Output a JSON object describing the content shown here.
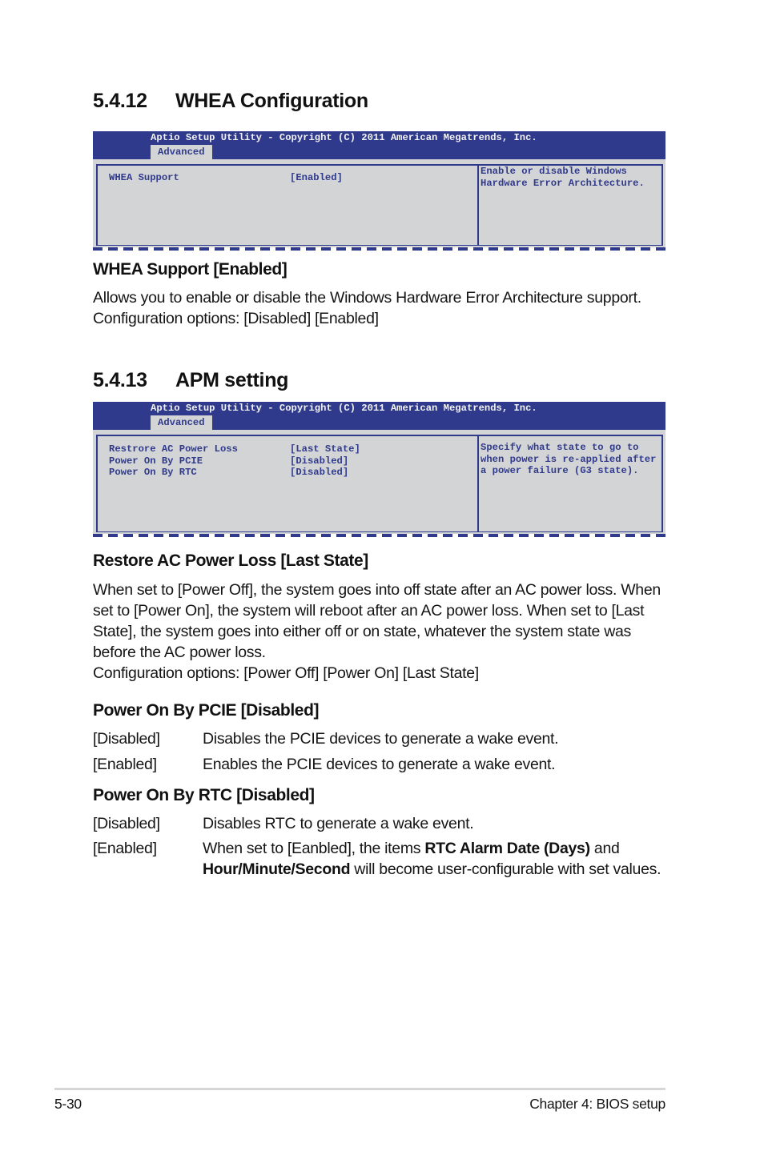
{
  "sections": [
    {
      "number": "5.4.12",
      "title": "WHEA Configuration",
      "bios": {
        "header_title": "Aptio Setup Utility - Copyright (C) 2011 American Megatrends, Inc.",
        "tab": "Advanced",
        "items": [
          {
            "label": "WHEA Support",
            "value": "[Enabled]"
          }
        ],
        "help_text": "Enable or disable Windows\nHardware Error Architecture."
      },
      "subsections": [
        {
          "heading": "WHEA Support [Enabled]",
          "paragraphs": [
            "Allows you to enable or disable the Windows Hardware Error Architecture support. Configuration options: [Disabled] [Enabled]"
          ]
        }
      ]
    },
    {
      "number": "5.4.13",
      "title": "APM setting",
      "bios": {
        "header_title": "Aptio Setup Utility - Copyright (C) 2011 American Megatrends, Inc.",
        "tab": "Advanced",
        "items": [
          {
            "label": "Restrore AC Power Loss",
            "value": "[Last State]"
          },
          {
            "label": "Power On By PCIE",
            "value": "[Disabled]"
          },
          {
            "label": "Power On By RTC",
            "value": "[Disabled]"
          }
        ],
        "help_text": "Specify what state to go to\nwhen power is re-applied after\na power failure (G3 state)."
      },
      "subsections": [
        {
          "heading": "Restore AC Power Loss [Last State]",
          "paragraphs": [
            "When set to [Power Off], the system goes into off state after an AC power loss. When set to [Power On], the system will reboot after an AC power loss. When set to [Last State], the system goes into either off or on state, whatever the system state was before the AC power loss.",
            "Configuration options: [Power Off] [Power On] [Last State]"
          ]
        },
        {
          "heading": "Power On By PCIE [Disabled]",
          "options": [
            {
              "key": "[Disabled]",
              "desc": "Disables the PCIE devices to generate a wake event."
            },
            {
              "key": "[Enabled]",
              "desc": "Enables the PCIE devices to generate a wake event."
            }
          ]
        },
        {
          "heading": "Power On By RTC [Disabled]",
          "options": [
            {
              "key": "[Disabled]",
              "desc": "Disables RTC to generate a wake event."
            },
            {
              "key": "[Enabled]",
              "desc_parts": {
                "t1": "When set to [Eanbled], the items ",
                "b1": "RTC Alarm Date (Days)",
                "t2": " and ",
                "b2": "Hour/Minute/Second",
                "t3": " will become user-configurable with set values."
              }
            }
          ]
        }
      ]
    }
  ],
  "footer": {
    "page_number": "5-30",
    "chapter": "Chapter 4: BIOS setup"
  },
  "colors": {
    "bios_blue": "#303a8c",
    "bios_gray": "#d3d4d6",
    "text": "#151515"
  }
}
